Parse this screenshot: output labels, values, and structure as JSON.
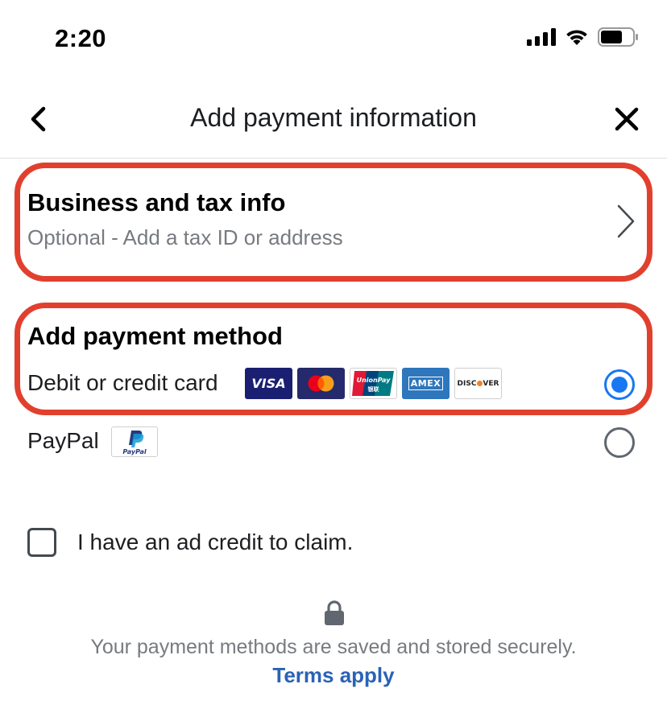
{
  "status_bar": {
    "time": "2:20"
  },
  "header": {
    "title": "Add payment information",
    "back_icon": "chevron-left-icon",
    "close_icon": "close-icon"
  },
  "business": {
    "title": "Business and tax info",
    "subtitle": "Optional - Add a tax ID or address"
  },
  "payment_method": {
    "section_title": "Add payment method",
    "options": [
      {
        "label": "Debit or credit card",
        "selected": true,
        "logos": [
          "VISA",
          "Mastercard",
          "UnionPay",
          "AMEX",
          "DISCOVER"
        ]
      },
      {
        "label": "PayPal",
        "selected": false,
        "logos": [
          "PayPal"
        ]
      }
    ]
  },
  "logo_text": {
    "visa": "VISA",
    "unionpay": "UnionPay",
    "unionpay_cn": "银联",
    "amex": "AMEX",
    "discover_a": "DISC",
    "discover_b": "VER",
    "paypal": "PayPal"
  },
  "ad_credit": {
    "label": "I have an ad credit to claim.",
    "checked": false
  },
  "footer": {
    "secure_text": "Your payment methods are saved and stored securely.",
    "terms_link": "Terms apply"
  },
  "colors": {
    "highlight": "#e1402e",
    "accent": "#1877f2",
    "link": "#2a62b6",
    "muted_text": "#777b80"
  }
}
